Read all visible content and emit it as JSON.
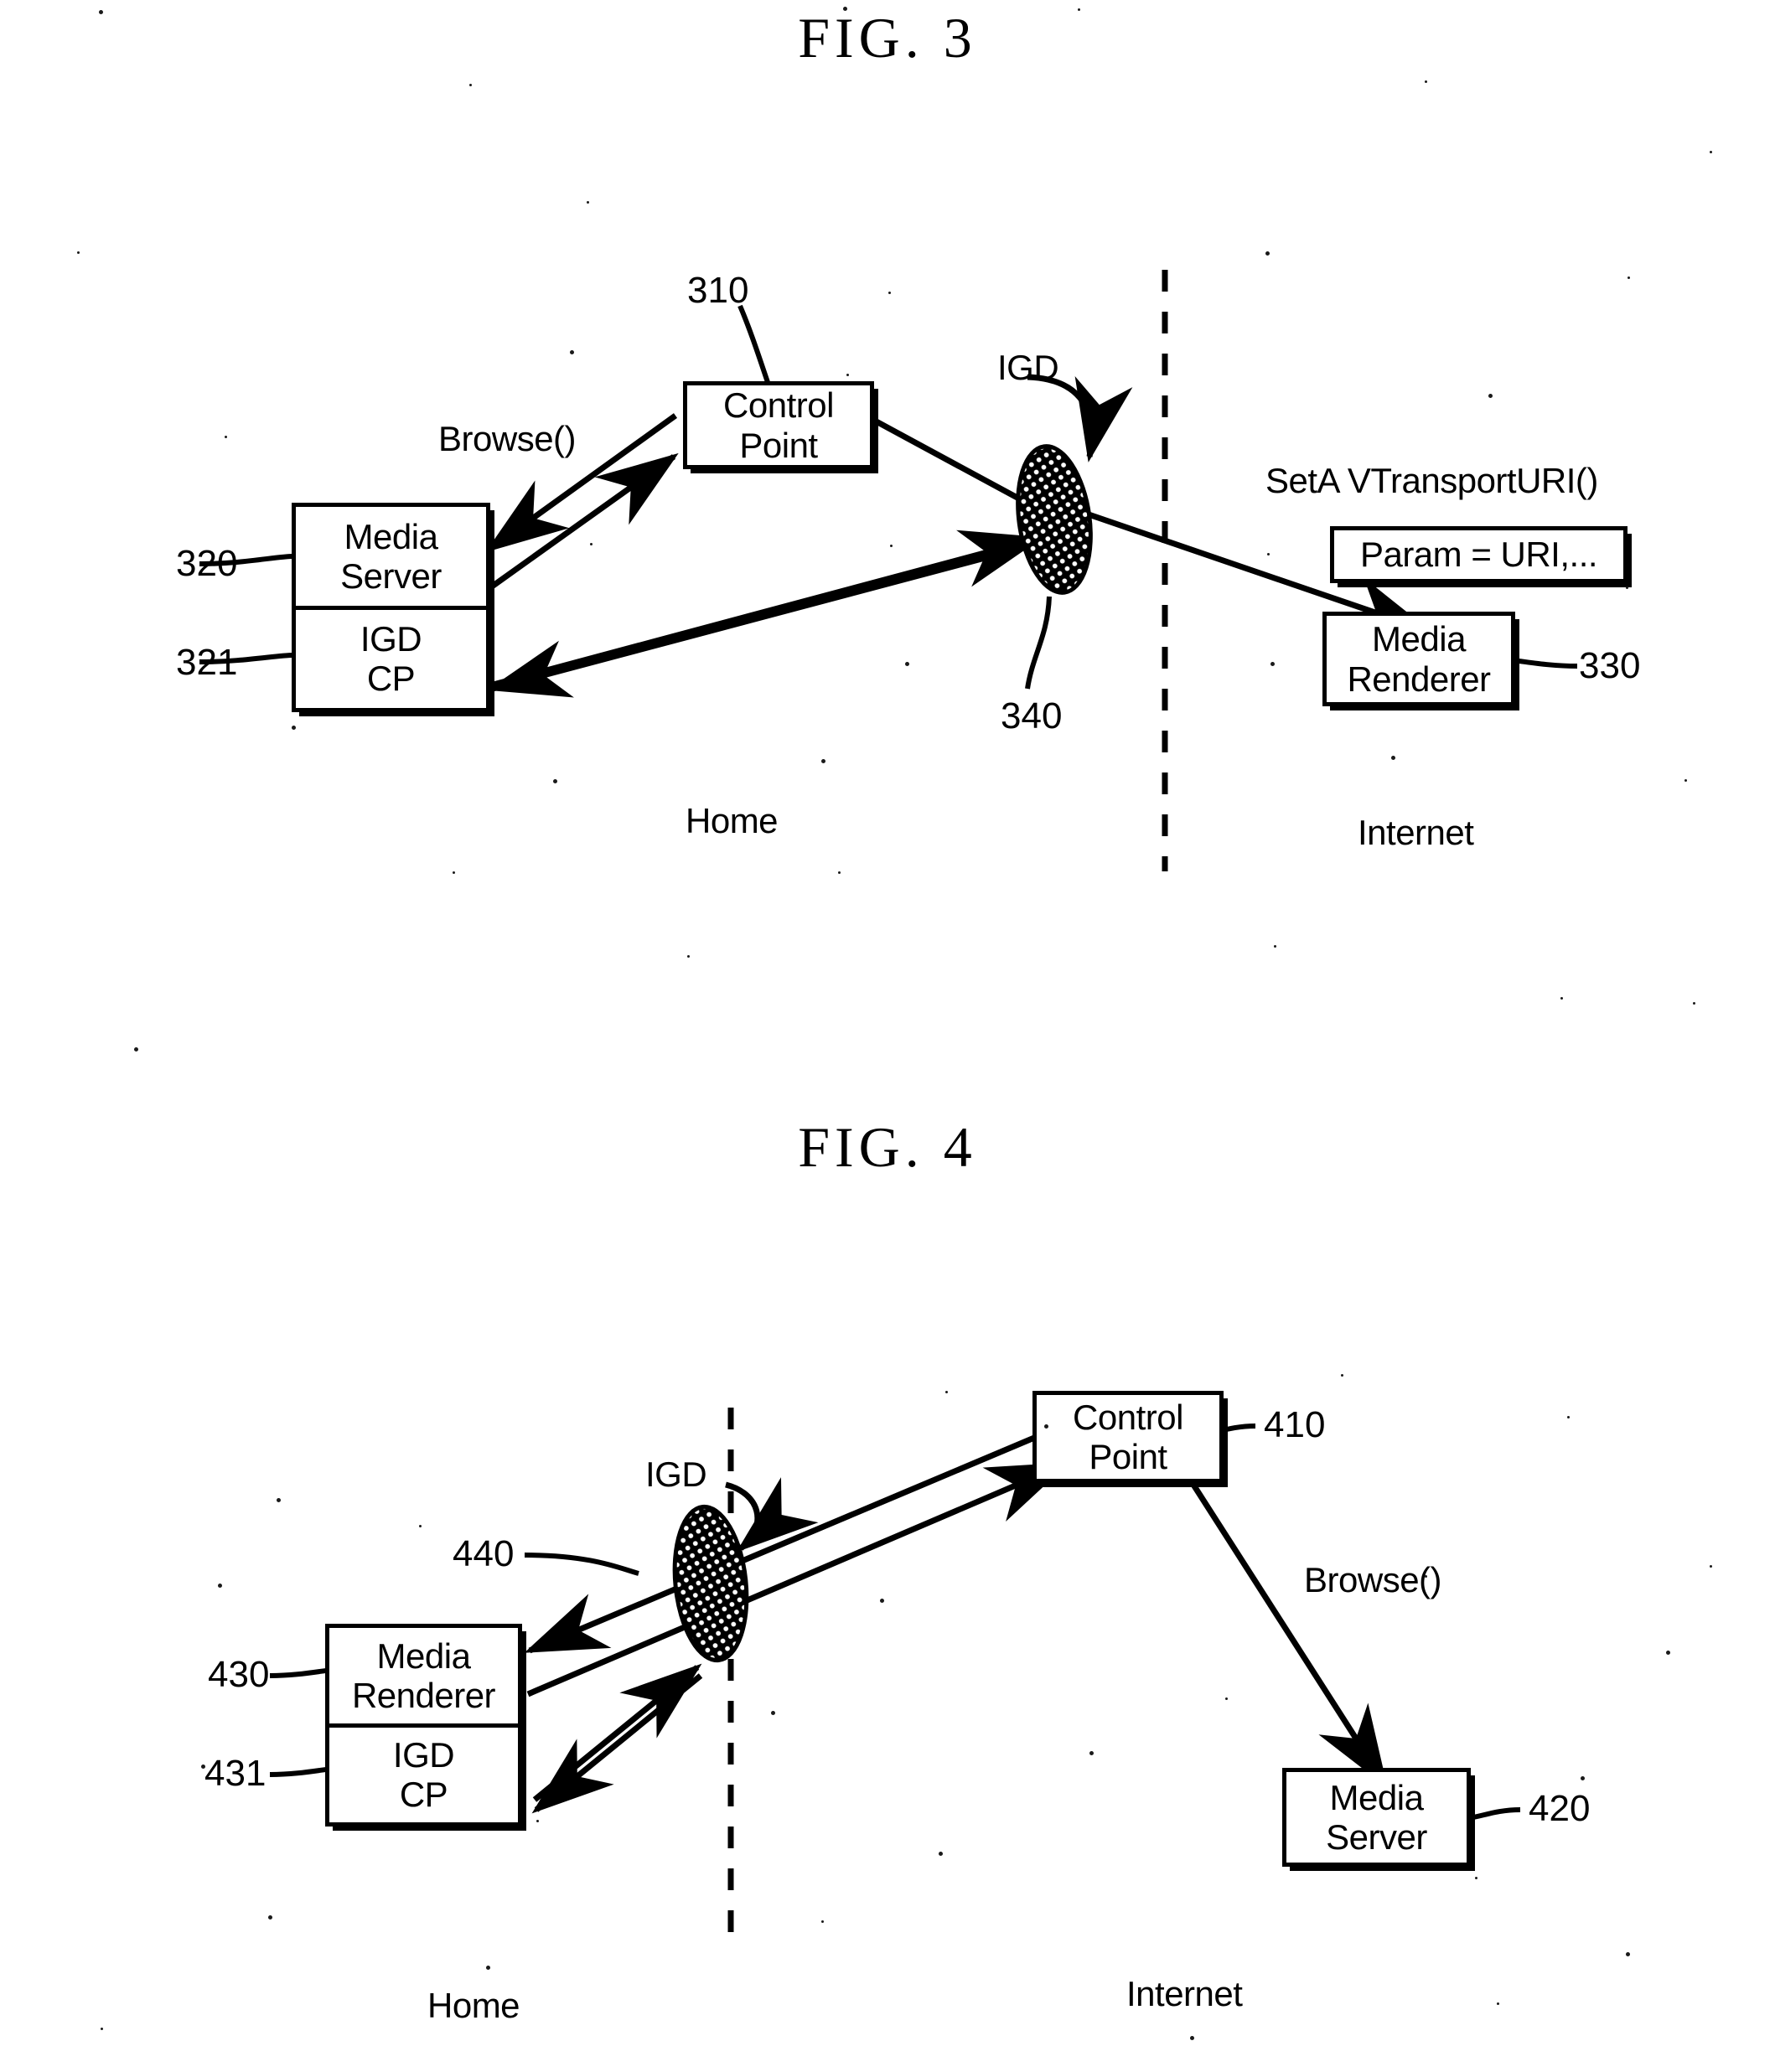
{
  "figures": [
    {
      "id": "fig3",
      "title": "FIG.  3",
      "zones": {
        "left": "Home",
        "right": "Internet"
      },
      "nodes": {
        "control_point": {
          "line1": "Control",
          "line2": "Point",
          "ref": "310"
        },
        "media_server": {
          "line1": "Media",
          "line2": "Server",
          "ref": "320"
        },
        "igd_cp": {
          "line1": "IGD",
          "line2": "CP",
          "ref": "321"
        },
        "media_renderer": {
          "line1": "Media",
          "line2": "Renderer",
          "ref": "330"
        },
        "igd_gateway": {
          "label": "IGD",
          "ref": "340"
        }
      },
      "annotations": {
        "browse": "Browse()",
        "setav": "SetA VTransportURI()",
        "param": "Param = URI,..."
      }
    },
    {
      "id": "fig4",
      "title": "FIG.  4",
      "zones": {
        "left": "Home",
        "right": "Internet"
      },
      "nodes": {
        "control_point": {
          "line1": "Control",
          "line2": "Point",
          "ref": "410"
        },
        "media_renderer": {
          "line1": "Media",
          "line2": "Renderer",
          "ref": "430"
        },
        "igd_cp": {
          "line1": "IGD",
          "line2": "CP",
          "ref": "431"
        },
        "media_server": {
          "line1": "Media",
          "line2": "Server",
          "ref": "420"
        },
        "igd_gateway": {
          "label": "IGD",
          "ref": "440"
        }
      },
      "annotations": {
        "browse": "Browse()"
      }
    }
  ]
}
